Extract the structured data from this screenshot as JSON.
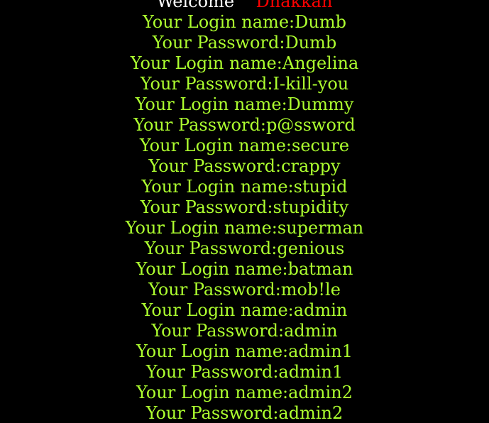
{
  "welcome": {
    "word": "Welcome",
    "name": "Dhakkan",
    "colors": {
      "word": "#ffffff",
      "name": "#ff0000"
    }
  },
  "credentials": {
    "login_prefix": "Your Login name:",
    "password_prefix": "Your Password:",
    "color": "#adff2f",
    "entries": [
      {
        "login": "Dumb",
        "password": "Dumb"
      },
      {
        "login": "Angelina",
        "password": "I-kill-you"
      },
      {
        "login": "Dummy",
        "password": "p@ssword"
      },
      {
        "login": "secure",
        "password": "crappy"
      },
      {
        "login": "stupid",
        "password": "stupidity"
      },
      {
        "login": "superman",
        "password": "genious"
      },
      {
        "login": "batman",
        "password": "mob!le"
      },
      {
        "login": "admin",
        "password": "admin"
      },
      {
        "login": "admin1",
        "password": "admin1"
      },
      {
        "login": "admin2",
        "password": "admin2"
      }
    ]
  }
}
